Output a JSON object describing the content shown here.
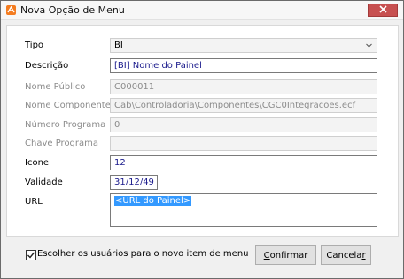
{
  "window": {
    "title": "Nova Opção de Menu"
  },
  "form": {
    "tipo": {
      "label": "Tipo",
      "value": "BI"
    },
    "descricao": {
      "label": "Descrição",
      "value": "[BI] Nome do Painel"
    },
    "nome_publico": {
      "label": "Nome Público",
      "value": "C000011"
    },
    "nome_componente": {
      "label": "Nome Componente",
      "value": "Cab\\Controladoria\\Componentes\\CGC0Integracoes.ecf"
    },
    "numero_programa": {
      "label": "Número Programa",
      "value": "0"
    },
    "chave_programa": {
      "label": "Chave Programa",
      "value": ""
    },
    "icone": {
      "label": "Icone",
      "value": "12"
    },
    "validade": {
      "label": "Validade",
      "value": "31/12/49"
    },
    "url": {
      "label": "URL",
      "value": "<URL do Painel>"
    }
  },
  "footer": {
    "checkbox_label": "Escolher os usuários para o novo item de menu",
    "checkbox_checked": true,
    "confirm": {
      "accel": "C",
      "rest": "onfirmar"
    },
    "cancel": {
      "pre": "Cancela",
      "accel": "r"
    }
  },
  "colors": {
    "close_button": "#c75050",
    "app_icon": "#f47c20",
    "selection": "#3399ff",
    "input_text": "#1a1a8c"
  },
  "icons": [
    "app-logo-icon",
    "close-icon",
    "chevron-down-icon",
    "checkmark-icon"
  ]
}
